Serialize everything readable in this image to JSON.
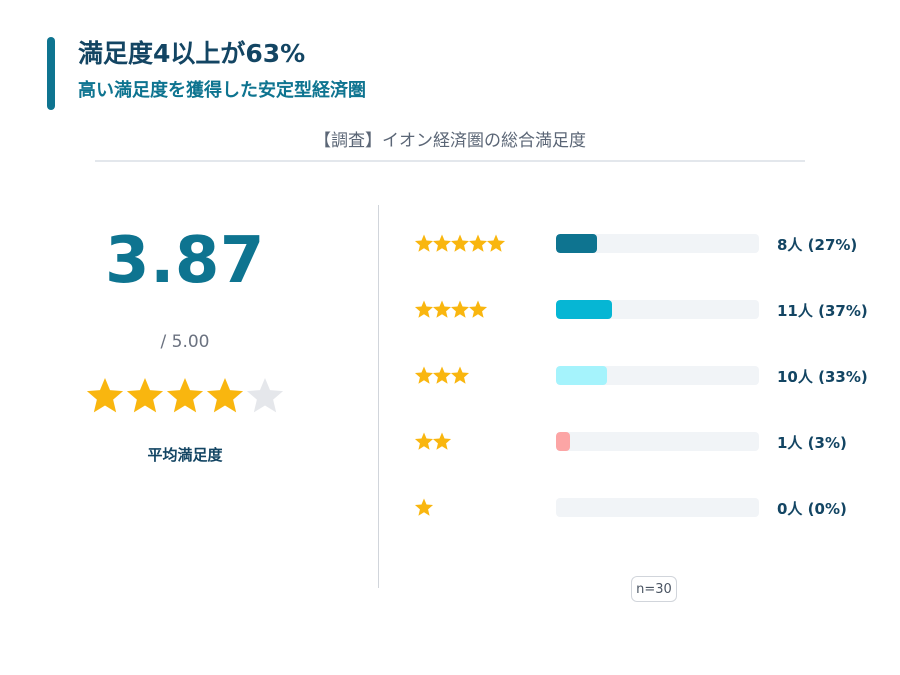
{
  "header": {
    "title": "満足度4以上が63%",
    "subtitle": "高い満足度を獲得した安定型経済圏",
    "survey_label": "【調査】イオン経済圏の総合満足度"
  },
  "summary": {
    "score": "3.87",
    "max_label": "/ 5.00",
    "score_value": 3.87,
    "max_value": 5,
    "avg_label": "平均満足度"
  },
  "colors": {
    "accent": "#0e7490",
    "title": "#134563",
    "star_on": "#f9b60f",
    "star_off": "#e5e7eb",
    "track": "#f1f4f7"
  },
  "chart_data": {
    "type": "bar",
    "orientation": "horizontal",
    "categories": [
      "★★★★★",
      "★★★★",
      "★★★",
      "★★",
      "★"
    ],
    "star_counts": [
      5,
      4,
      3,
      2,
      1
    ],
    "values": [
      8,
      11,
      10,
      1,
      0
    ],
    "percents": [
      27,
      37,
      33,
      3,
      0
    ],
    "labels": [
      "8人 (27%)",
      "11人 (37%)",
      "10人 (33%)",
      "1人 (3%)",
      "0人 (0%)"
    ],
    "colors": [
      "#0e7490",
      "#06b6d4",
      "#a5f3fc",
      "#fca5a5",
      "#e5e7eb"
    ],
    "xlim": [
      0,
      40
    ],
    "grid": false,
    "legend": "none"
  },
  "footer": {
    "n_label": "n=30"
  }
}
